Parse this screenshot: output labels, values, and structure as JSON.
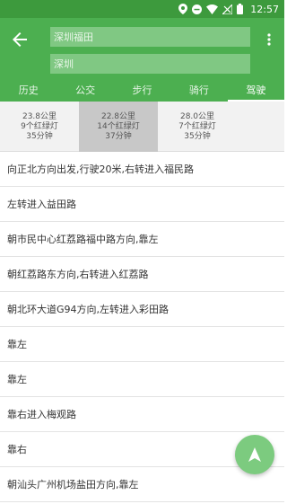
{
  "status_bar": {
    "time": "12:57",
    "icons": [
      "location-icon",
      "dnd-icon",
      "wifi-icon",
      "no-signal-icon",
      "battery-icon"
    ]
  },
  "colors": {
    "status_bar": "#3d9a3d",
    "app_bar": "#4caf50",
    "field_background": "#80c883",
    "fab": "#7ccb7f",
    "selected_option": "#c8c8c8"
  },
  "toolbar": {
    "back_icon": "arrow-back-icon",
    "more_icon": "more-vertical-icon",
    "from_value": "深圳福田",
    "to_value": "深圳"
  },
  "tabs": [
    {
      "label": "历史"
    },
    {
      "label": "公交"
    },
    {
      "label": "步行"
    },
    {
      "label": "骑行"
    },
    {
      "label": "驾驶"
    }
  ],
  "active_tab": "驾驶",
  "route_options": [
    {
      "distance": "23.8公里",
      "lights": "9个红绿灯",
      "time": "35分钟"
    },
    {
      "distance": "22.8公里",
      "lights": "14个红绿灯",
      "time": "37分钟"
    },
    {
      "distance": "28.0公里",
      "lights": "7个红绿灯",
      "time": "35分钟"
    }
  ],
  "selected_option": 2,
  "steps": [
    "向正北方向出发,行驶20米,右转进入福民路",
    "左转进入益田路",
    "朝市民中心红荔路福中路方向,靠左",
    "朝红荔路东方向,右转进入红荔路",
    "朝北环大道G94方向,左转进入彩田路",
    "靠左",
    "靠左",
    "靠右进入梅观路",
    "靠右",
    "朝汕头广州机场盐田方向,靠左"
  ],
  "fab_icon": "navigation-arrow-icon"
}
